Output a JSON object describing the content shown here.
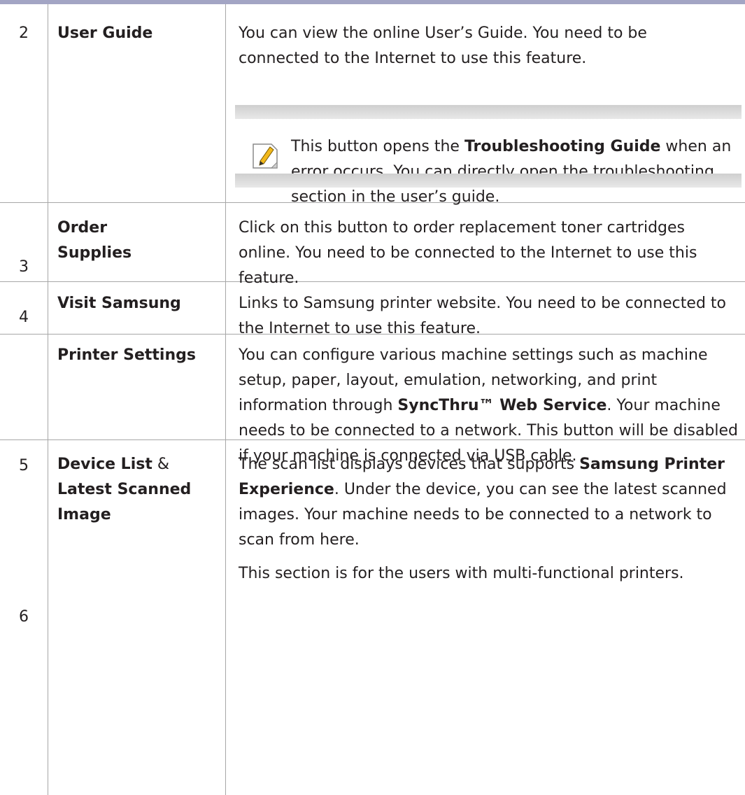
{
  "rows": [
    {
      "num": "2",
      "name": "User Guide",
      "desc": "You can view the online User’s Guide. You need to be connected to the Internet to use this feature.",
      "note": {
        "icon": "note-pencil-icon",
        "text_before": "This button opens the ",
        "bold": "Troubleshooting Guide",
        "text_after": " when an error occurs. You can directly open the troubleshooting section in the user’s guide."
      }
    },
    {
      "num": "3",
      "name_line1": "Order",
      "name_line2": "Supplies",
      "desc": "Click on this button to order replacement toner cartridges online. You need to be connected to the Internet to use this feature."
    },
    {
      "num": "4",
      "name": "Visit Samsung",
      "desc": "Links to Samsung printer website. You need to be connected to the Internet to use this feature."
    },
    {
      "num": "5",
      "name": "Printer Settings",
      "desc_before": "You can configure various machine settings such as machine setup, paper, layout, emulation, networking, and print information through ",
      "desc_bold": "SyncThru™ Web Service",
      "desc_after": ". Your machine needs to be connected to a network. This button will be disabled if your machine is connected via USB cable."
    },
    {
      "num": "6",
      "name_part1": "Device List",
      "name_amp": " & ",
      "name_part2": "Latest Scanned Image",
      "desc_before": "The scan list displays devices that supports ",
      "desc_bold": "Samsung Printer Experience",
      "desc_after": ". Under the device, you can see the latest scanned images. Your machine needs to be connected to a network to scan from here.",
      "desc2": "This section is for the users with multi-functional printers."
    }
  ],
  "colors": {
    "top_bar": "#a3a5c4",
    "rule": "#a7a7a7",
    "note_bar": "#d4d4d4"
  }
}
